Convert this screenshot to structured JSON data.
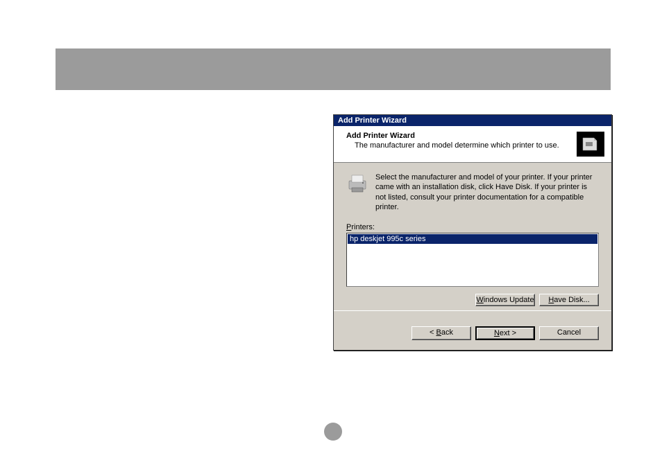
{
  "dialog": {
    "title": "Add Printer Wizard",
    "header_title": "Add Printer Wizard",
    "header_subtitle": "The manufacturer and model determine which printer to use.",
    "instruction": "Select the manufacturer and model of your printer. If your printer came with an installation disk, click Have Disk. If your printer is not listed, consult your printer documentation for a compatible printer.",
    "printers_label_prefix": "P",
    "printers_label_rest": "rinters:",
    "printers": [
      "hp deskjet 995c series"
    ],
    "buttons": {
      "windows_update_prefix": "W",
      "windows_update_rest": "indows Update",
      "have_disk_prefix": "H",
      "have_disk_rest": "ave Disk...",
      "back_prefix": "< ",
      "back_underline": "B",
      "back_rest": "ack",
      "next_underline": "N",
      "next_rest": "ext >",
      "cancel": "Cancel"
    }
  }
}
